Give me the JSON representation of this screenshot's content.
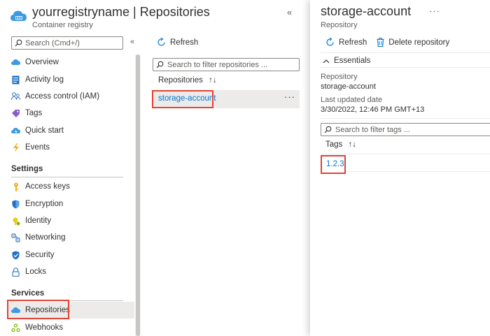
{
  "header": {
    "title": "yourregistryname | Repositories",
    "subtitle": "Container registry",
    "collapse_glyph": "«"
  },
  "menu": {
    "search_placeholder": "Search (Cmd+/)",
    "collapse_glyph": "«",
    "items_top": [
      {
        "label": "Overview",
        "icon": "cloud-icon"
      },
      {
        "label": "Activity log",
        "icon": "log-icon"
      },
      {
        "label": "Access control (IAM)",
        "icon": "people-icon"
      },
      {
        "label": "Tags",
        "icon": "tag-icon"
      },
      {
        "label": "Quick start",
        "icon": "cloud-lightning-icon"
      },
      {
        "label": "Events",
        "icon": "bolt-icon"
      }
    ],
    "settings_label": "Settings",
    "items_settings": [
      {
        "label": "Access keys",
        "icon": "key-icon"
      },
      {
        "label": "Encryption",
        "icon": "shield-icon"
      },
      {
        "label": "Identity",
        "icon": "identity-icon"
      },
      {
        "label": "Networking",
        "icon": "network-icon"
      },
      {
        "label": "Security",
        "icon": "shield-icon"
      },
      {
        "label": "Locks",
        "icon": "lock-icon"
      }
    ],
    "services_label": "Services",
    "items_services": [
      {
        "label": "Repositories",
        "icon": "cloud-icon",
        "selected": true
      },
      {
        "label": "Webhooks",
        "icon": "webhook-icon"
      }
    ]
  },
  "repo_list": {
    "refresh_label": "Refresh",
    "filter_placeholder": "Search to filter repositories ...",
    "column_header": "Repositories",
    "sort_glyph": "↑↓",
    "rows": [
      {
        "name": "storage-account"
      }
    ],
    "row_more_glyph": "···"
  },
  "detail": {
    "title": "storage-account",
    "subtitle": "Repository",
    "more_glyph": "···",
    "refresh_label": "Refresh",
    "delete_label": "Delete repository",
    "essentials_label": "Essentials",
    "repository_label": "Repository",
    "repository_value": "storage-account",
    "updated_label": "Last updated date",
    "updated_value": "3/30/2022, 12:46 PM GMT+13",
    "tags_filter_placeholder": "Search to filter tags ...",
    "tags_header": "Tags",
    "sort_glyph": "↑↓",
    "tags": [
      "1.2.3"
    ]
  },
  "colors": {
    "accent": "#0078d4",
    "highlight": "#e34234",
    "selected_bg": "#edebe9"
  }
}
